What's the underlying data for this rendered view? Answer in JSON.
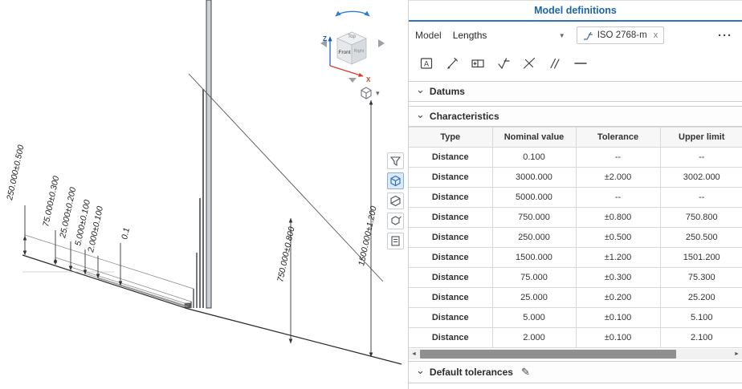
{
  "icons": {
    "chevron_down": "⌄",
    "dropdown_caret": "▼",
    "menu_caret": "▾",
    "close": "x",
    "overflow": "···",
    "pencil": "✎",
    "scroll_left": "◄",
    "scroll_right": "►"
  },
  "viewcube": {
    "top": "Top",
    "front": "Front",
    "right": "Right",
    "axis_z": "Z",
    "axis_x": "X"
  },
  "viewport": {
    "dimension_labels": [
      "250.000±0.500",
      "75.000±0.300",
      "25.000±0.200",
      "5.000±0.100",
      "2.000±0.100",
      "0.1",
      "750.000±0.800",
      "1500.000±1.200"
    ]
  },
  "panel": {
    "title": "Model definitions",
    "model": {
      "label": "Model",
      "value": "Lengths"
    },
    "standard_chip": {
      "label": "ISO 2768-m"
    },
    "sections": {
      "datums": "Datums",
      "characteristics": "Characteristics",
      "default_tolerances": "Default tolerances"
    },
    "table": {
      "headers": [
        "Type",
        "Nominal value",
        "Tolerance",
        "Upper limit"
      ],
      "rows": [
        [
          "Distance",
          "0.100",
          "--",
          "--"
        ],
        [
          "Distance",
          "3000.000",
          "±2.000",
          "3002.000"
        ],
        [
          "Distance",
          "5000.000",
          "--",
          "--"
        ],
        [
          "Distance",
          "750.000",
          "±0.800",
          "750.800"
        ],
        [
          "Distance",
          "250.000",
          "±0.500",
          "250.500"
        ],
        [
          "Distance",
          "1500.000",
          "±1.200",
          "1501.200"
        ],
        [
          "Distance",
          "75.000",
          "±0.300",
          "75.300"
        ],
        [
          "Distance",
          "25.000",
          "±0.200",
          "25.200"
        ],
        [
          "Distance",
          "5.000",
          "±0.100",
          "5.100"
        ],
        [
          "Distance",
          "2.000",
          "±0.100",
          "2.100"
        ]
      ]
    }
  }
}
